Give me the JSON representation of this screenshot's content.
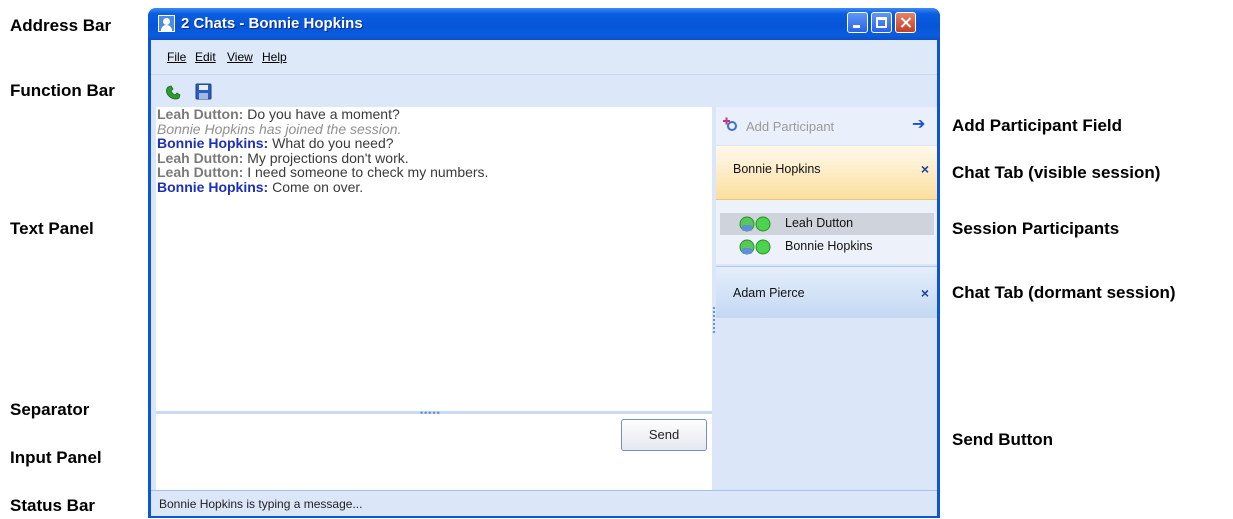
{
  "window": {
    "title": "2 Chats - Bonnie Hopkins",
    "icons": {
      "app": "user-icon",
      "minimize": "minimize-icon",
      "maximize": "maximize-icon",
      "close": "close-icon"
    }
  },
  "menu": [
    {
      "label": "File"
    },
    {
      "label": "Edit"
    },
    {
      "label": "View"
    },
    {
      "label": "Help"
    }
  ],
  "toolbar": {
    "call_icon": "phone-icon",
    "save_icon": "floppy-disk-icon"
  },
  "messages": [
    {
      "speaker": "Leah Dutton:",
      "text": " Do you have a moment?",
      "color": "gray"
    },
    {
      "system": "Bonnie Hopkins has joined the session."
    },
    {
      "speaker": "Bonnie Hopkins:",
      "text": " What do you need?",
      "color": "blue"
    },
    {
      "speaker": "Leah Dutton:",
      "text": " My projections don't work.",
      "color": "gray"
    },
    {
      "speaker": "Leah Dutton:",
      "text": " I need someone to check my numbers.",
      "color": "gray"
    },
    {
      "speaker": "Bonnie Hopkins:",
      "text": " Come on over.",
      "color": "blue"
    }
  ],
  "input": {
    "send_label": "Send"
  },
  "side": {
    "add_placeholder": "Add Participant",
    "add_icon": "add-person-icon",
    "go_icon": "arrow-right-icon",
    "active_tab": {
      "name": "Bonnie Hopkins",
      "close": "×"
    },
    "participants": [
      {
        "name": "Leah Dutton",
        "icon": "participant-status-icon"
      },
      {
        "name": "Bonnie Hopkins",
        "icon": "participant-status-icon"
      }
    ],
    "dormant_tab": {
      "name": "Adam Pierce",
      "close": "×"
    }
  },
  "status": {
    "text": "Bonnie Hopkins is typing a message..."
  },
  "labels_left": {
    "address_bar": "Address Bar",
    "function_bar": "Function Bar",
    "text_panel": "Text Panel",
    "separator": "Separator",
    "input_panel": "Input Panel",
    "status_bar": "Status Bar"
  },
  "labels_right": {
    "add_participant": "Add Participant Field",
    "chat_tab_visible": "Chat Tab (visible session)",
    "session_participants": "Session Participants",
    "chat_tab_dormant": "Chat Tab (dormant session)",
    "send_button": "Send Button"
  },
  "colors": {
    "title_blue": "#0655d8",
    "speaker_blue": "#1d30b8",
    "speaker_gray": "#7a7a7a",
    "active_tab": "#fde9be"
  }
}
